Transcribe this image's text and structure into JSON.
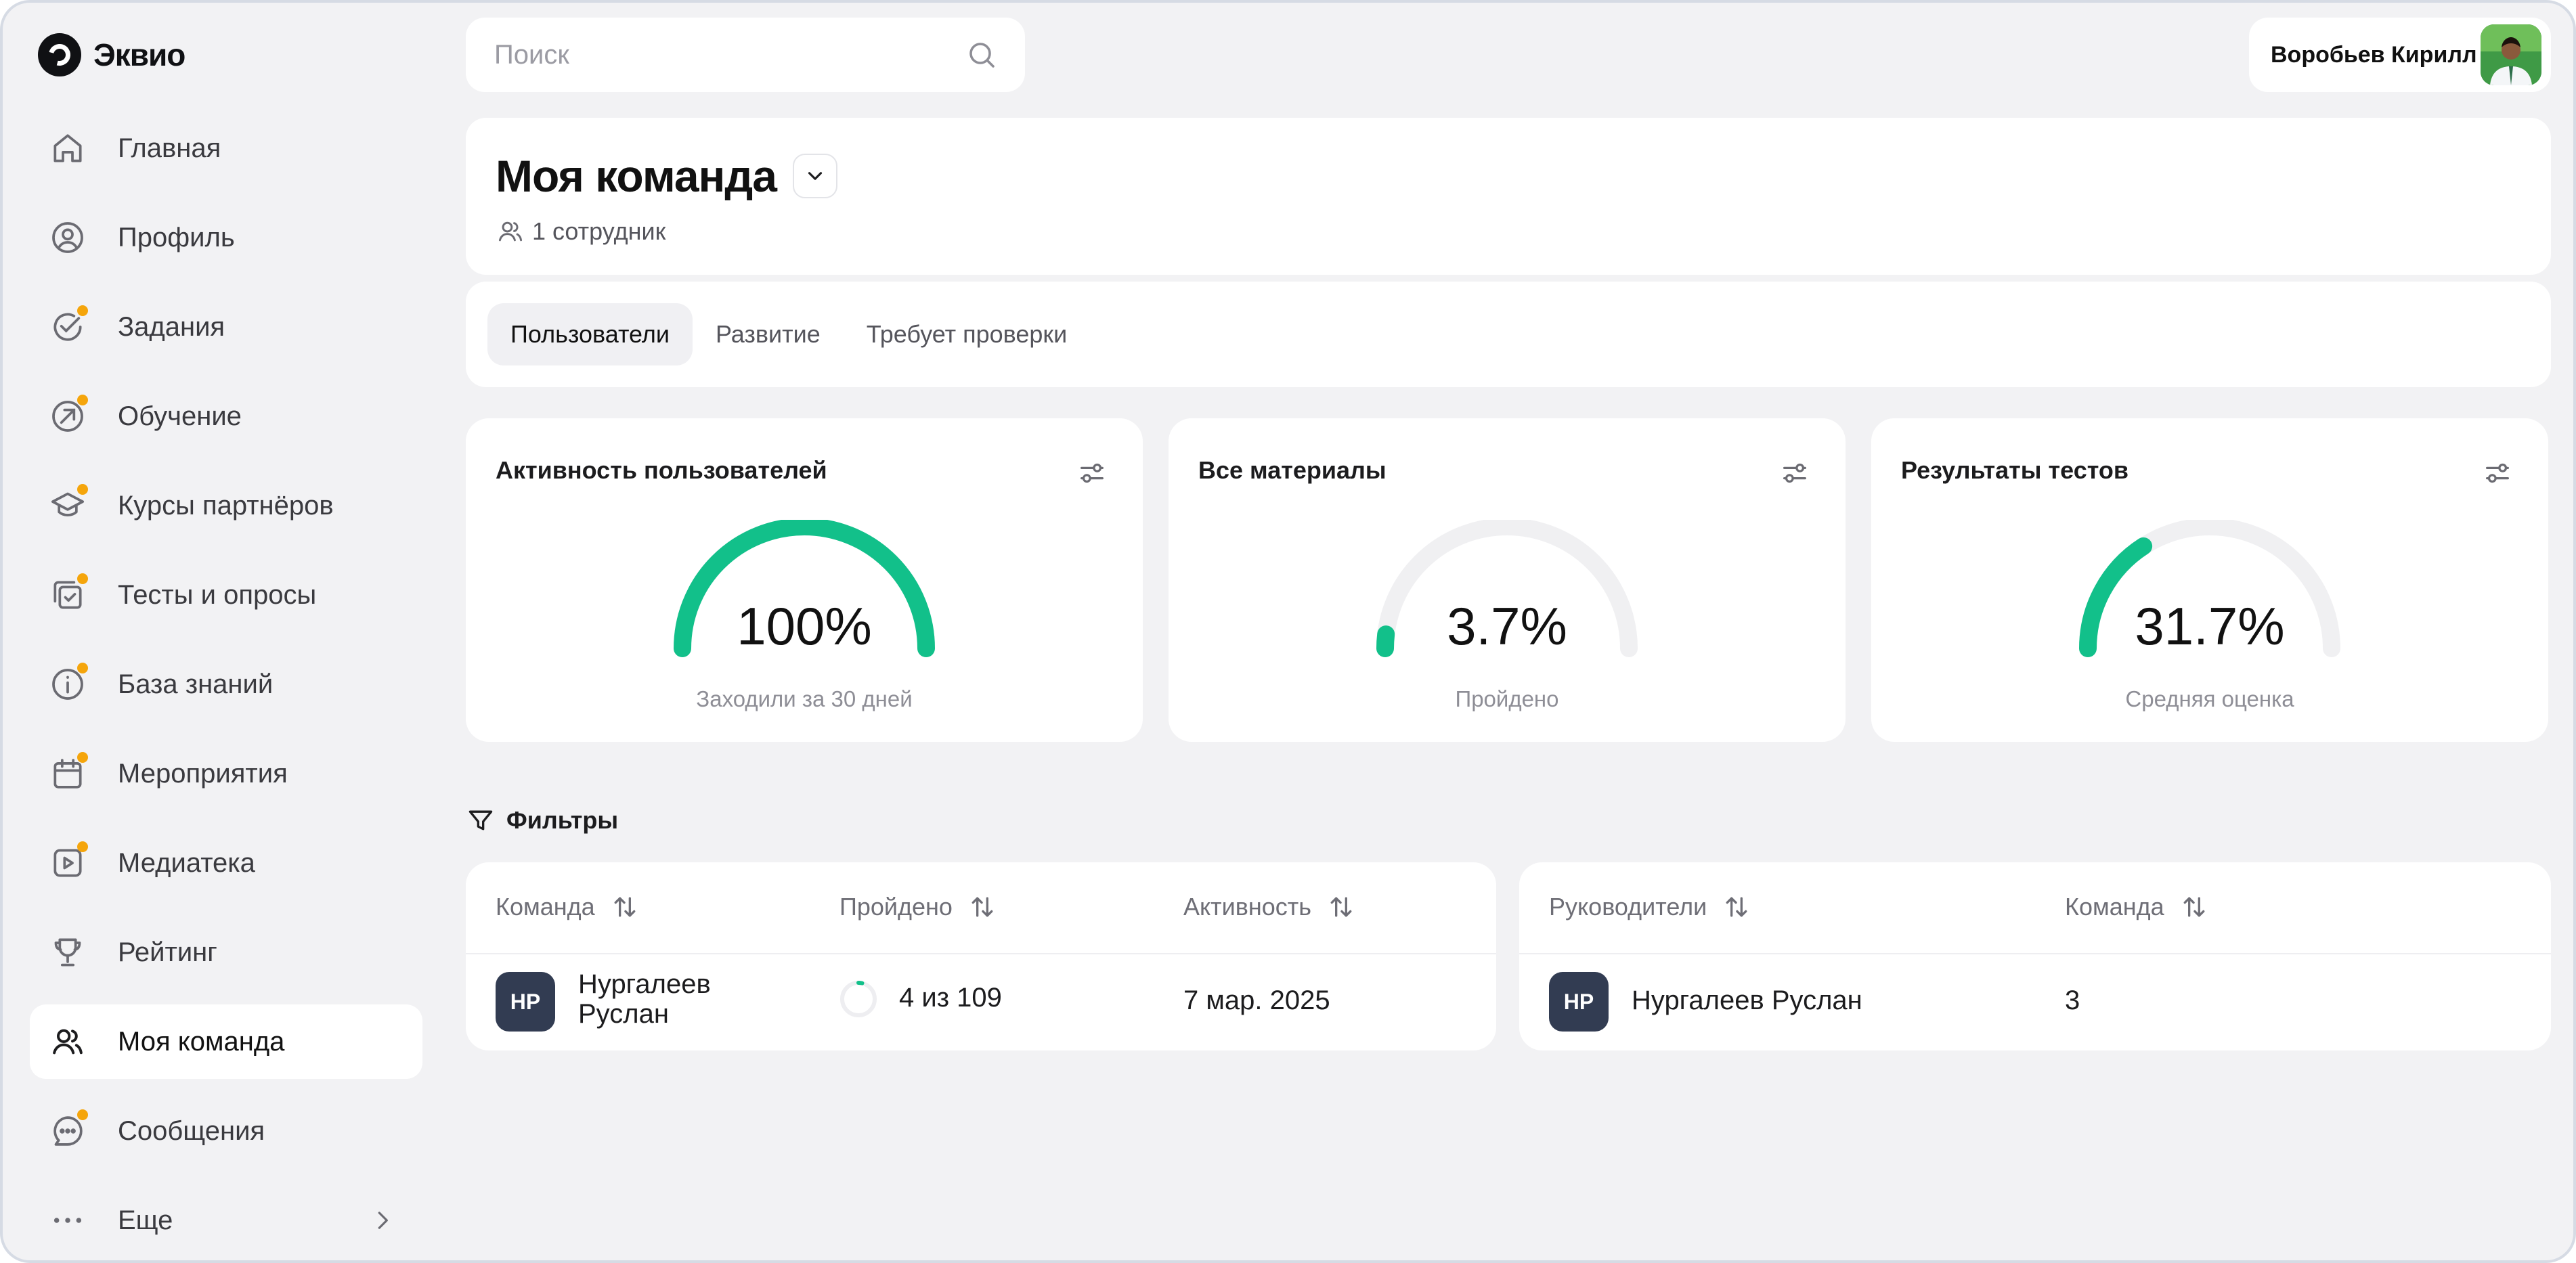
{
  "app": {
    "logo_text": "Эквио"
  },
  "sidebar": {
    "items": [
      {
        "label": "Главная",
        "icon": "home-icon",
        "badge": false
      },
      {
        "label": "Профиль",
        "icon": "user-circle-icon",
        "badge": false
      },
      {
        "label": "Задания",
        "icon": "check-circle-icon",
        "badge": true
      },
      {
        "label": "Обучение",
        "icon": "compass-arrow-icon",
        "badge": true
      },
      {
        "label": "Курсы партнёров",
        "icon": "graduation-cap-icon",
        "badge": true
      },
      {
        "label": "Тесты и опросы",
        "icon": "checklist-icon",
        "badge": true
      },
      {
        "label": "База знаний",
        "icon": "info-icon",
        "badge": true
      },
      {
        "label": "Мероприятия",
        "icon": "calendar-icon",
        "badge": true
      },
      {
        "label": "Медиатека",
        "icon": "play-square-icon",
        "badge": true
      },
      {
        "label": "Рейтинг",
        "icon": "trophy-icon",
        "badge": false
      },
      {
        "label": "Моя команда",
        "icon": "users-icon",
        "badge": false,
        "active": true
      },
      {
        "label": "Сообщения",
        "icon": "chat-icon",
        "badge": true
      },
      {
        "label": "Еще",
        "icon": "more-dots-icon",
        "badge": false
      }
    ]
  },
  "search": {
    "placeholder": "Поиск"
  },
  "user": {
    "name": "Воробьев Кирилл"
  },
  "header": {
    "title": "Моя команда",
    "employee_count": "1 сотрудник"
  },
  "tabs": [
    {
      "label": "Пользователи",
      "active": true
    },
    {
      "label": "Развитие",
      "active": false
    },
    {
      "label": "Требует проверки",
      "active": false
    }
  ],
  "stats": [
    {
      "title": "Активность пользователей",
      "value_text": "100%",
      "value": 100,
      "caption": "Заходили за 30 дней"
    },
    {
      "title": "Все материалы",
      "value_text": "3.7%",
      "value": 3.7,
      "caption": "Пройдено"
    },
    {
      "title": "Результаты тестов",
      "value_text": "31.7%",
      "value": 31.7,
      "caption": "Средняя оценка"
    }
  ],
  "filters": {
    "label": "Фильтры"
  },
  "team_table": {
    "headers": [
      "Команда",
      "Пройдено",
      "Активность"
    ],
    "rows": [
      {
        "initials": "НР",
        "name_line1": "Нургалеев",
        "name_line2": "Руслан",
        "completed": "4 из 109",
        "completed_fraction": 0.0367,
        "activity": "7 мар. 2025"
      }
    ]
  },
  "managers_table": {
    "headers": [
      "Руководители",
      "Команда"
    ],
    "rows": [
      {
        "initials": "НР",
        "name": "Нургалеев Руслан",
        "team": "3"
      }
    ]
  },
  "colors": {
    "accent": "#12c08a",
    "track": "#f0f0f2",
    "badge": "#f5a50b",
    "initials_bg": "#323c52"
  }
}
